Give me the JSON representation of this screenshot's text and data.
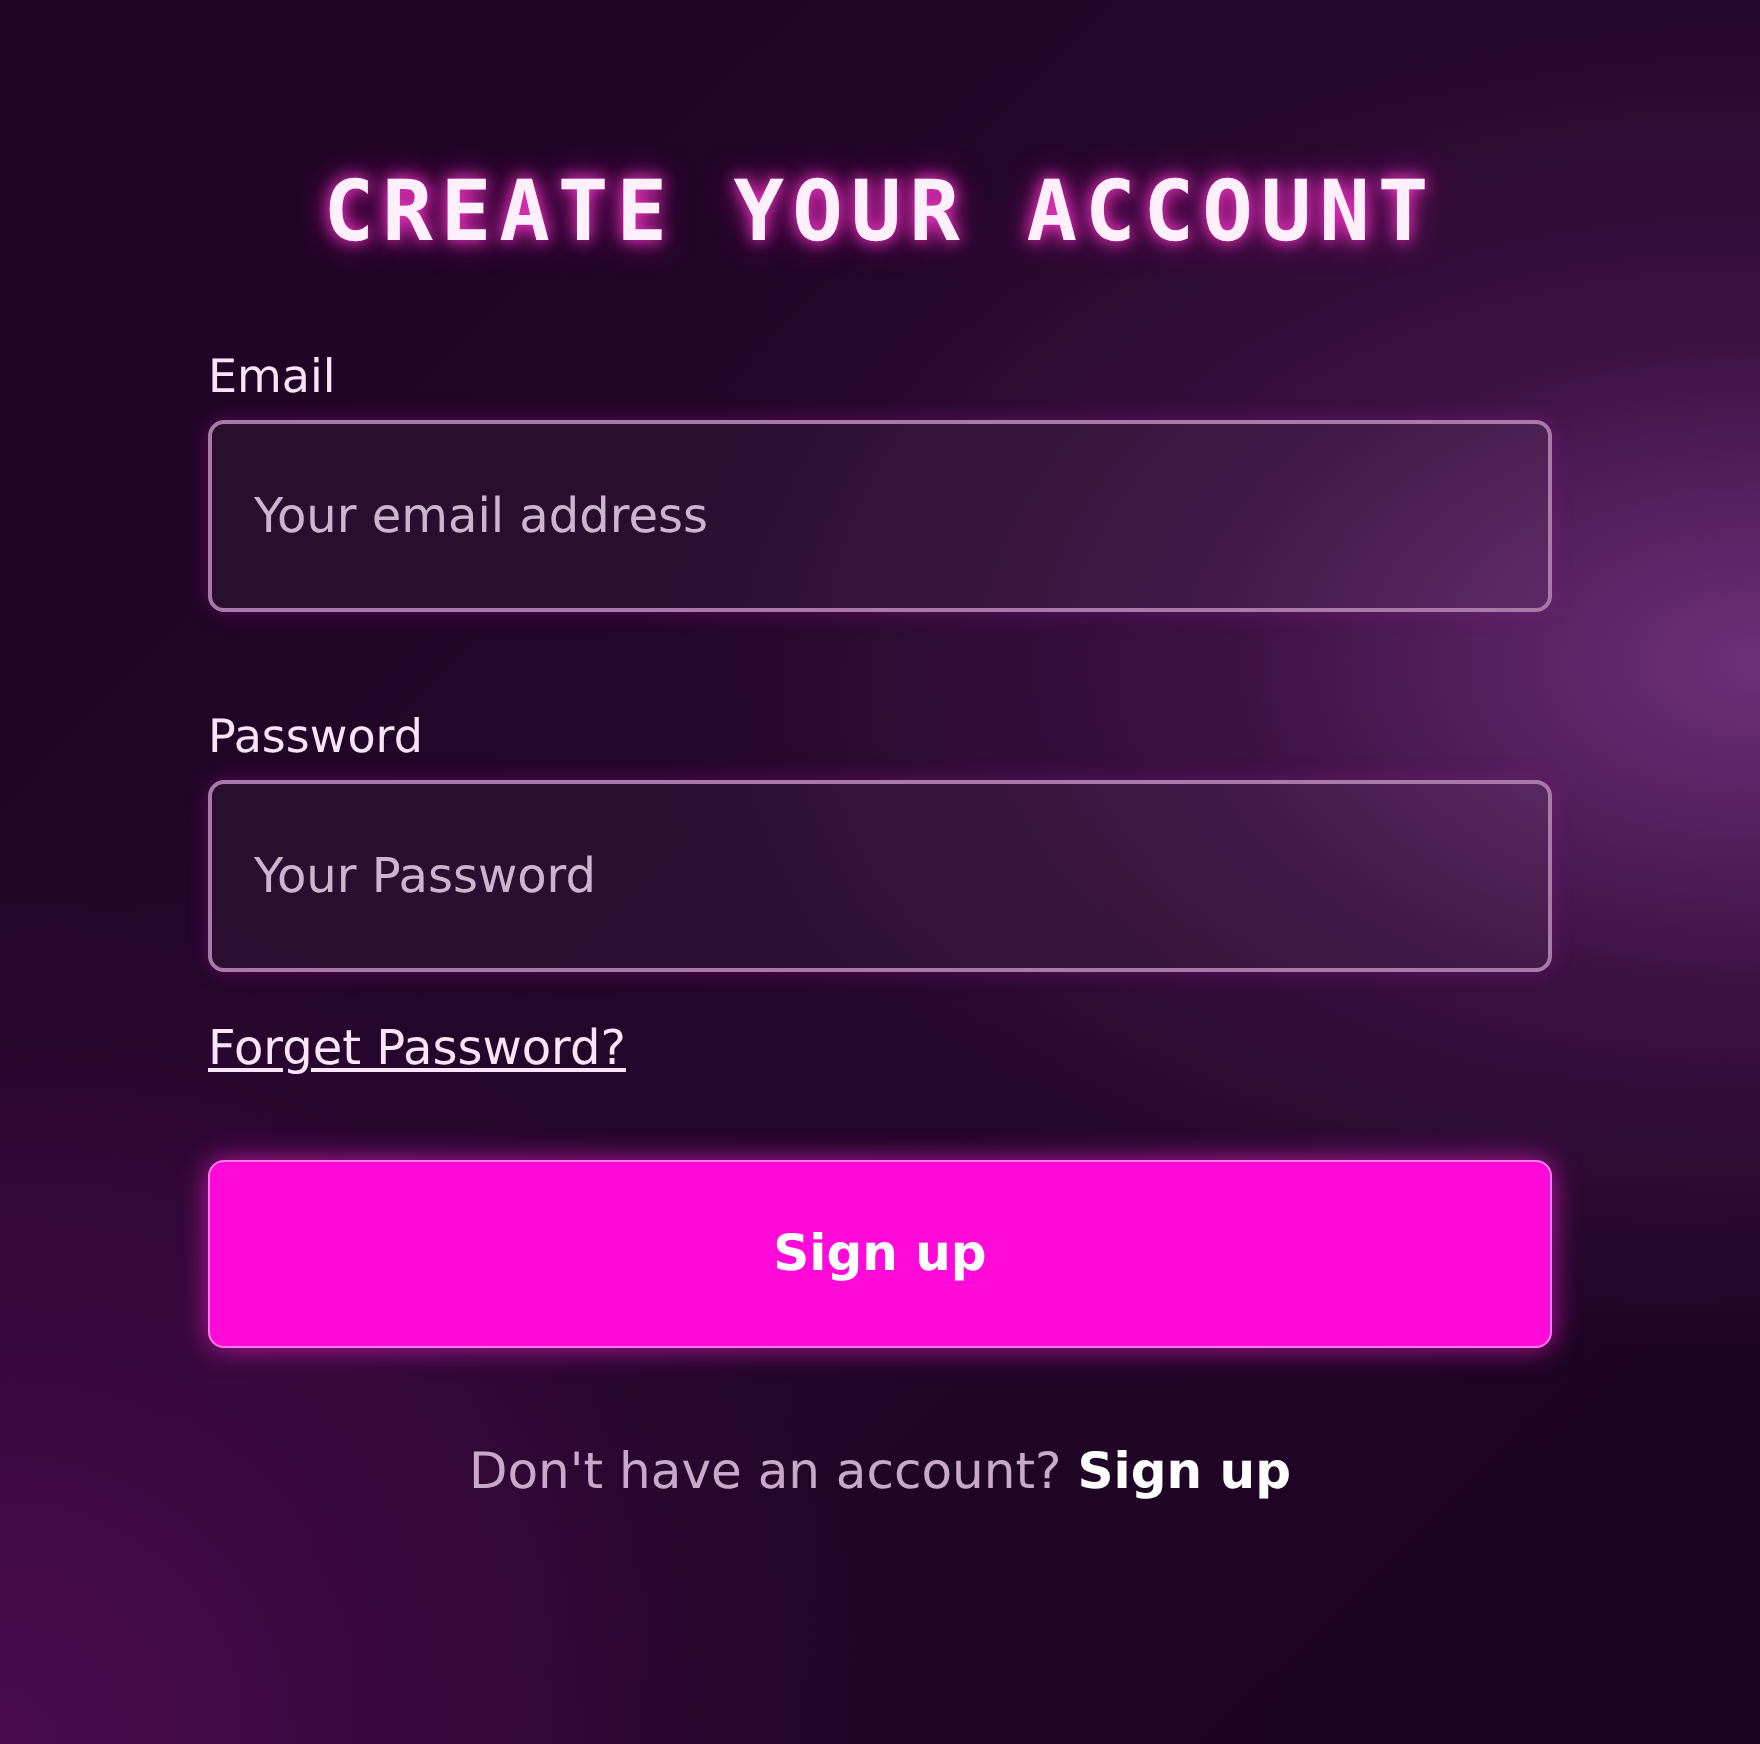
{
  "title": "CREATE YOUR ACCOUNT",
  "fields": [
    {
      "label": "Email",
      "placeholder": "Your email address"
    },
    {
      "label": "Password",
      "placeholder": "Your Password"
    }
  ],
  "forgot_link": "Forget Password?",
  "submit_button": "Sign up",
  "footer": {
    "text": "Don't have an account?",
    "link": "Sign up"
  }
}
